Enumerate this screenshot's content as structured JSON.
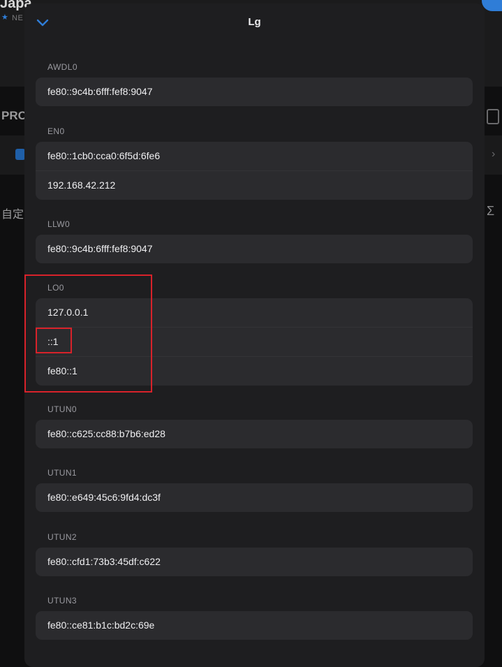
{
  "background": {
    "title": "Japa",
    "subtitle": "NE",
    "section": "PRO",
    "custom": "自定"
  },
  "sheet": {
    "title": "Lg",
    "sections": [
      {
        "label": "AWDL0",
        "values": [
          "fe80::9c4b:6fff:fef8:9047"
        ]
      },
      {
        "label": "EN0",
        "values": [
          "fe80::1cb0:cca0:6f5d:6fe6",
          "192.168.42.212"
        ]
      },
      {
        "label": "LLW0",
        "values": [
          "fe80::9c4b:6fff:fef8:9047"
        ]
      },
      {
        "label": "LO0",
        "values": [
          "127.0.0.1",
          "::1",
          "fe80::1"
        ]
      },
      {
        "label": "UTUN0",
        "values": [
          "fe80::c625:cc88:b7b6:ed28"
        ]
      },
      {
        "label": "UTUN1",
        "values": [
          "fe80::e649:45c6:9fd4:dc3f"
        ]
      },
      {
        "label": "UTUN2",
        "values": [
          "fe80::cfd1:73b3:45df:c622"
        ]
      },
      {
        "label": "UTUN3",
        "values": [
          "fe80::ce81:b1c:bd2c:69e"
        ]
      }
    ]
  },
  "colors": {
    "accent": "#2f7dd7",
    "highlight": "#d8222a",
    "sheet_bg": "#1e1e20",
    "row_bg": "#2b2b2e"
  }
}
